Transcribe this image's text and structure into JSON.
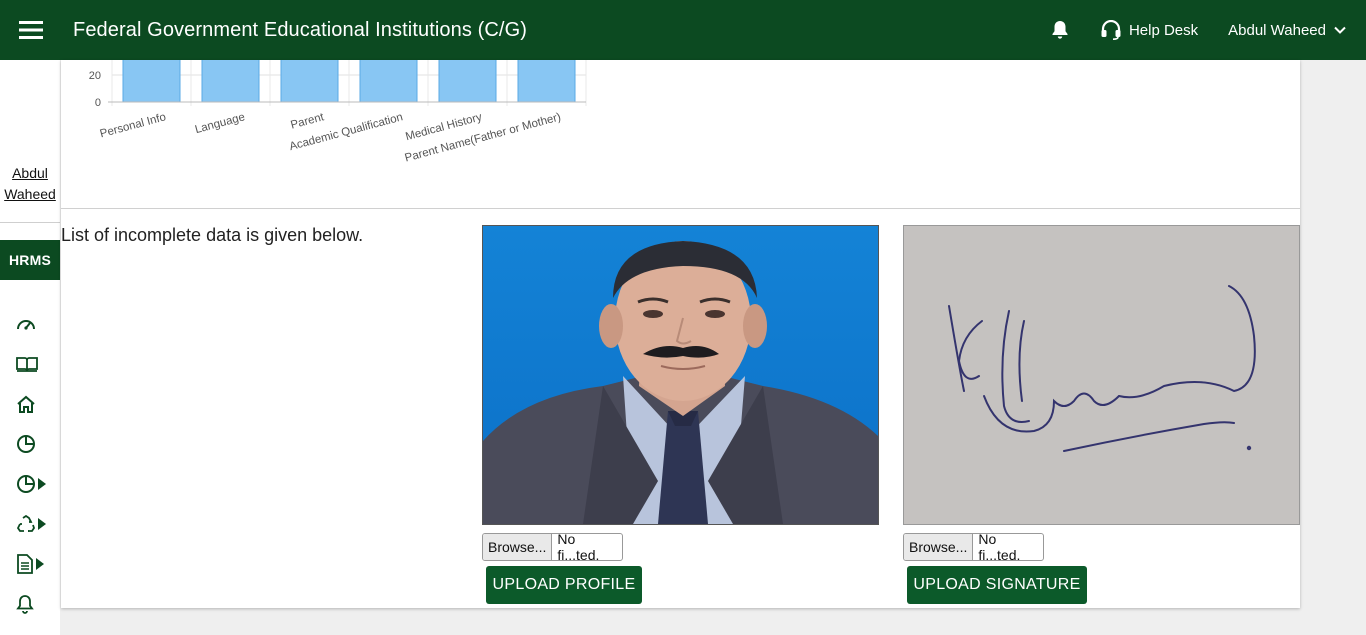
{
  "header": {
    "title": "Federal Government Educational Institutions (C/G)",
    "help_desk": "Help Desk",
    "user_name": "Abdul Waheed"
  },
  "sidebar": {
    "user_line1": "Abdul",
    "user_line2": "Waheed",
    "section": "HRMS",
    "icons": [
      "dashboard-icon",
      "book-icon",
      "home-icon",
      "pie-chart-icon",
      "pie-chart-expand-icon",
      "recycle-expand-icon",
      "document-expand-icon",
      "bell-icon"
    ]
  },
  "chart_data": {
    "type": "bar",
    "categories": [
      "Personal Info",
      "Language",
      "Parent",
      "Academic Qualification",
      "Medical History",
      "Parent Name(Father or Mother)"
    ],
    "visible_ticks": [
      "0",
      "20"
    ],
    "bar_color": "#88c6f3"
  },
  "main": {
    "notice": "List of incomplete data is given below.",
    "profile": {
      "browse_label": "Browse...",
      "file_name": "No fi...ted.",
      "upload_label": "UPLOAD PROFILE"
    },
    "signature": {
      "browse_label": "Browse...",
      "file_name": "No fi...ted.",
      "upload_label": "UPLOAD SIGNATURE"
    }
  },
  "colors": {
    "brand": "#0c4a21",
    "button": "#0c5a2a"
  }
}
